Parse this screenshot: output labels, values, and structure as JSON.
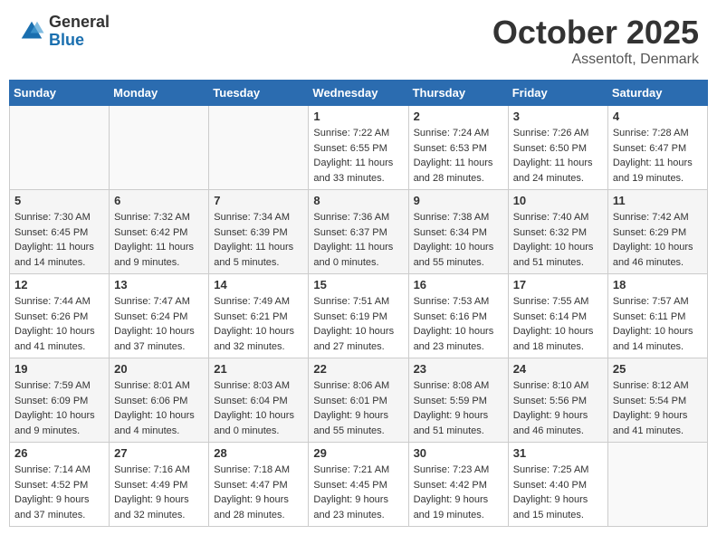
{
  "header": {
    "logo_general": "General",
    "logo_blue": "Blue",
    "month": "October 2025",
    "location": "Assentoft, Denmark"
  },
  "days_of_week": [
    "Sunday",
    "Monday",
    "Tuesday",
    "Wednesday",
    "Thursday",
    "Friday",
    "Saturday"
  ],
  "weeks": [
    [
      {
        "day": "",
        "info": ""
      },
      {
        "day": "",
        "info": ""
      },
      {
        "day": "",
        "info": ""
      },
      {
        "day": "1",
        "info": "Sunrise: 7:22 AM\nSunset: 6:55 PM\nDaylight: 11 hours\nand 33 minutes."
      },
      {
        "day": "2",
        "info": "Sunrise: 7:24 AM\nSunset: 6:53 PM\nDaylight: 11 hours\nand 28 minutes."
      },
      {
        "day": "3",
        "info": "Sunrise: 7:26 AM\nSunset: 6:50 PM\nDaylight: 11 hours\nand 24 minutes."
      },
      {
        "day": "4",
        "info": "Sunrise: 7:28 AM\nSunset: 6:47 PM\nDaylight: 11 hours\nand 19 minutes."
      }
    ],
    [
      {
        "day": "5",
        "info": "Sunrise: 7:30 AM\nSunset: 6:45 PM\nDaylight: 11 hours\nand 14 minutes."
      },
      {
        "day": "6",
        "info": "Sunrise: 7:32 AM\nSunset: 6:42 PM\nDaylight: 11 hours\nand 9 minutes."
      },
      {
        "day": "7",
        "info": "Sunrise: 7:34 AM\nSunset: 6:39 PM\nDaylight: 11 hours\nand 5 minutes."
      },
      {
        "day": "8",
        "info": "Sunrise: 7:36 AM\nSunset: 6:37 PM\nDaylight: 11 hours\nand 0 minutes."
      },
      {
        "day": "9",
        "info": "Sunrise: 7:38 AM\nSunset: 6:34 PM\nDaylight: 10 hours\nand 55 minutes."
      },
      {
        "day": "10",
        "info": "Sunrise: 7:40 AM\nSunset: 6:32 PM\nDaylight: 10 hours\nand 51 minutes."
      },
      {
        "day": "11",
        "info": "Sunrise: 7:42 AM\nSunset: 6:29 PM\nDaylight: 10 hours\nand 46 minutes."
      }
    ],
    [
      {
        "day": "12",
        "info": "Sunrise: 7:44 AM\nSunset: 6:26 PM\nDaylight: 10 hours\nand 41 minutes."
      },
      {
        "day": "13",
        "info": "Sunrise: 7:47 AM\nSunset: 6:24 PM\nDaylight: 10 hours\nand 37 minutes."
      },
      {
        "day": "14",
        "info": "Sunrise: 7:49 AM\nSunset: 6:21 PM\nDaylight: 10 hours\nand 32 minutes."
      },
      {
        "day": "15",
        "info": "Sunrise: 7:51 AM\nSunset: 6:19 PM\nDaylight: 10 hours\nand 27 minutes."
      },
      {
        "day": "16",
        "info": "Sunrise: 7:53 AM\nSunset: 6:16 PM\nDaylight: 10 hours\nand 23 minutes."
      },
      {
        "day": "17",
        "info": "Sunrise: 7:55 AM\nSunset: 6:14 PM\nDaylight: 10 hours\nand 18 minutes."
      },
      {
        "day": "18",
        "info": "Sunrise: 7:57 AM\nSunset: 6:11 PM\nDaylight: 10 hours\nand 14 minutes."
      }
    ],
    [
      {
        "day": "19",
        "info": "Sunrise: 7:59 AM\nSunset: 6:09 PM\nDaylight: 10 hours\nand 9 minutes."
      },
      {
        "day": "20",
        "info": "Sunrise: 8:01 AM\nSunset: 6:06 PM\nDaylight: 10 hours\nand 4 minutes."
      },
      {
        "day": "21",
        "info": "Sunrise: 8:03 AM\nSunset: 6:04 PM\nDaylight: 10 hours\nand 0 minutes."
      },
      {
        "day": "22",
        "info": "Sunrise: 8:06 AM\nSunset: 6:01 PM\nDaylight: 9 hours\nand 55 minutes."
      },
      {
        "day": "23",
        "info": "Sunrise: 8:08 AM\nSunset: 5:59 PM\nDaylight: 9 hours\nand 51 minutes."
      },
      {
        "day": "24",
        "info": "Sunrise: 8:10 AM\nSunset: 5:56 PM\nDaylight: 9 hours\nand 46 minutes."
      },
      {
        "day": "25",
        "info": "Sunrise: 8:12 AM\nSunset: 5:54 PM\nDaylight: 9 hours\nand 41 minutes."
      }
    ],
    [
      {
        "day": "26",
        "info": "Sunrise: 7:14 AM\nSunset: 4:52 PM\nDaylight: 9 hours\nand 37 minutes."
      },
      {
        "day": "27",
        "info": "Sunrise: 7:16 AM\nSunset: 4:49 PM\nDaylight: 9 hours\nand 32 minutes."
      },
      {
        "day": "28",
        "info": "Sunrise: 7:18 AM\nSunset: 4:47 PM\nDaylight: 9 hours\nand 28 minutes."
      },
      {
        "day": "29",
        "info": "Sunrise: 7:21 AM\nSunset: 4:45 PM\nDaylight: 9 hours\nand 23 minutes."
      },
      {
        "day": "30",
        "info": "Sunrise: 7:23 AM\nSunset: 4:42 PM\nDaylight: 9 hours\nand 19 minutes."
      },
      {
        "day": "31",
        "info": "Sunrise: 7:25 AM\nSunset: 4:40 PM\nDaylight: 9 hours\nand 15 minutes."
      },
      {
        "day": "",
        "info": ""
      }
    ]
  ]
}
